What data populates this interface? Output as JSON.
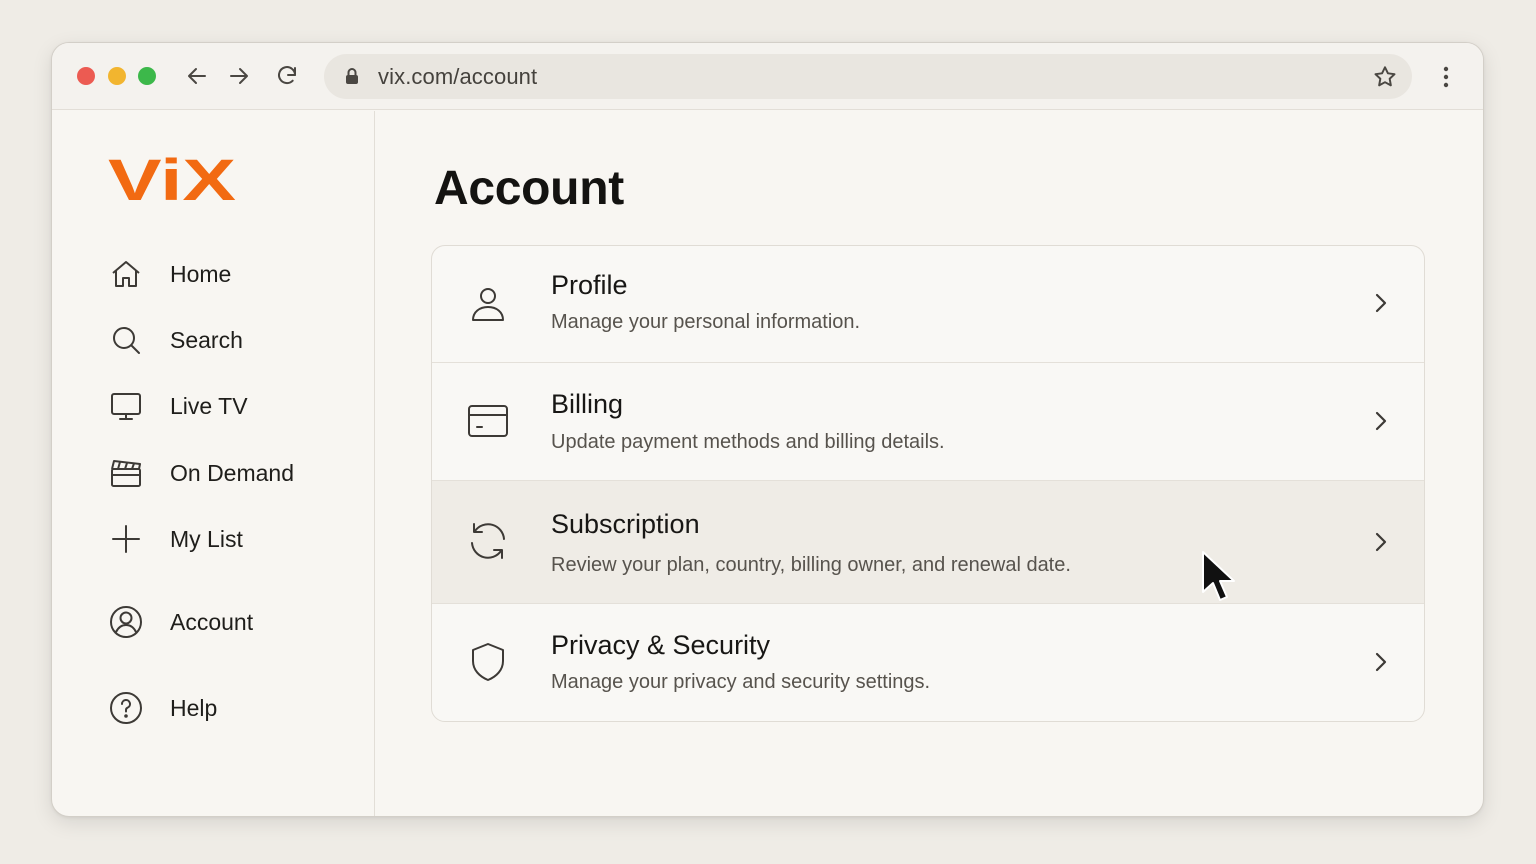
{
  "browser": {
    "url": "vix.com/account",
    "buttons": [
      "back",
      "forward",
      "reload",
      "bookmark",
      "menu"
    ]
  },
  "brand": {
    "logo_text": "ViX",
    "color": "#f26a12"
  },
  "sidebar": {
    "items": [
      {
        "label": "Home",
        "icon": "home-icon"
      },
      {
        "label": "Search",
        "icon": "search-icon"
      },
      {
        "label": "Live TV",
        "icon": "tv-icon"
      },
      {
        "label": "On Demand",
        "icon": "clapperboard-icon"
      },
      {
        "label": "My List",
        "icon": "plus-icon"
      },
      {
        "label": "Account",
        "icon": "user-circle-icon"
      },
      {
        "label": "Help",
        "icon": "help-circle-icon"
      }
    ]
  },
  "main": {
    "title": "Account",
    "rows": [
      {
        "title": "Profile",
        "description": "Manage your personal information.",
        "icon": "user-icon"
      },
      {
        "title": "Billing",
        "description": "Update payment methods and billing details.",
        "icon": "credit-card-icon"
      },
      {
        "title": "Subscription",
        "description": "Review your plan, country, billing owner, and renewal date.",
        "icon": "refresh-icon",
        "hovered": true
      },
      {
        "title": "Privacy & Security",
        "description": "Manage your privacy and security settings.",
        "icon": "shield-icon"
      }
    ]
  }
}
